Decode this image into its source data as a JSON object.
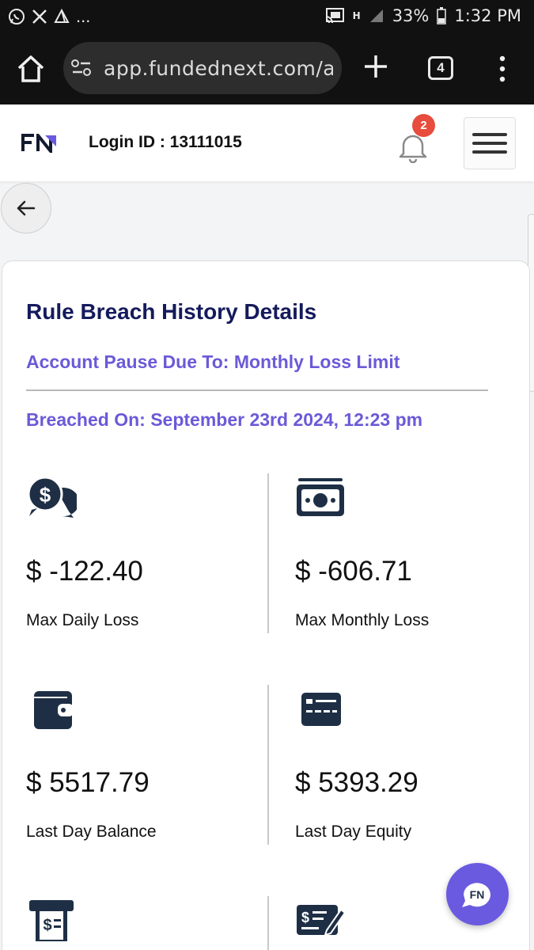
{
  "status_bar": {
    "notification_icons": [
      "whatsapp-icon",
      "x-icon",
      "drive-icon"
    ],
    "more": "...",
    "battery": "33%",
    "time": "1:32 PM",
    "signal_label": "H"
  },
  "browser": {
    "url": "app.fundednext.com/ac",
    "tab_count": "4"
  },
  "header": {
    "logo_text": "FN",
    "login_id": "Login ID : 13111015",
    "notification_count": "2"
  },
  "card": {
    "title": "Rule Breach History Details",
    "pause_reason": "Account Pause Due To: Monthly Loss Limit",
    "breached_on": "Breached On: September 23rd 2024, 12:23 pm",
    "stats": [
      {
        "icon": "dollar-chat-icon",
        "value": "$ -122.40",
        "label": "Max Daily Loss"
      },
      {
        "icon": "banknote-icon",
        "value": "$ -606.71",
        "label": "Max Monthly Loss"
      },
      {
        "icon": "wallet-icon",
        "value": "$ 5517.79",
        "label": "Last Day Balance"
      },
      {
        "icon": "card-icon",
        "value": "$ 5393.29",
        "label": "Last Day Equity"
      },
      {
        "icon": "receipt-icon",
        "value": "",
        "label": ""
      },
      {
        "icon": "check-sign-icon",
        "value": "",
        "label": ""
      }
    ]
  },
  "colors": {
    "title": "#141a5c",
    "accent": "#6a5ad8",
    "badge": "#e74c3c",
    "icon": "#1e2f45",
    "fab": "#6a5ae0"
  }
}
